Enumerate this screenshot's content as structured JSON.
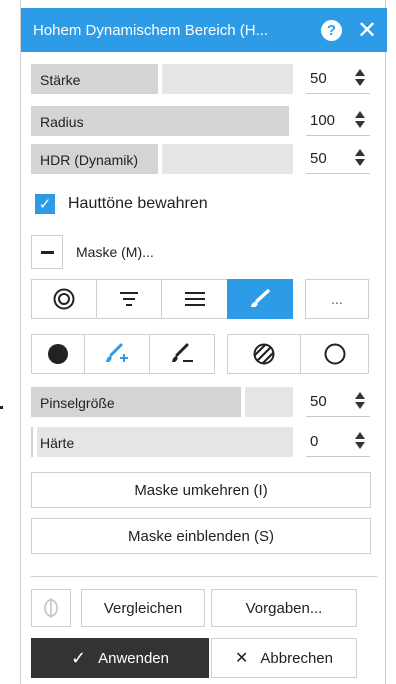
{
  "title": "Hohem Dynamischem Bereich (H...",
  "sliders": [
    {
      "label": "Stärke",
      "value": "50",
      "level": 0.5
    },
    {
      "label": "Radius",
      "value": "100",
      "level": 1.0
    },
    {
      "label": "HDR (Dynamik)",
      "value": "50",
      "level": 0.5
    }
  ],
  "preserve_skin": {
    "label": "Hauttöne bewahren",
    "checked": true
  },
  "mask": {
    "label": "Maske (M)...",
    "more_label": "..."
  },
  "brush_sliders": [
    {
      "label": "Pinselgröße",
      "value": "50",
      "level": 0.8
    },
    {
      "label": "Härte",
      "value": "0",
      "level": 0.0
    }
  ],
  "buttons": {
    "invert_mask": "Maske umkehren (I)",
    "show_mask": "Maske einblenden (S)",
    "compare": "Vergleichen",
    "presets": "Vorgaben...",
    "apply": "Anwenden",
    "cancel": "Abbrechen"
  },
  "icons": {
    "apply": "✓",
    "cancel": "✕",
    "help": "?",
    "close": "✕"
  },
  "colors": {
    "accent": "#2e9be6",
    "apply_bg": "#333333"
  }
}
